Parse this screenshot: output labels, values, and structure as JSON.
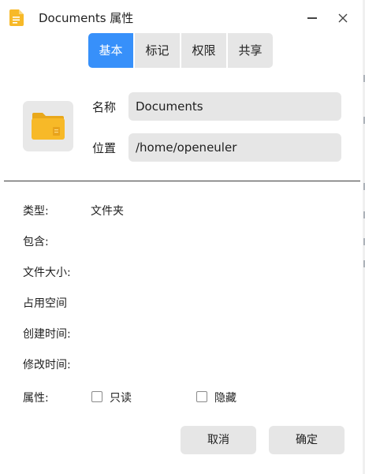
{
  "window": {
    "title": "Documents 属性"
  },
  "tabs": [
    {
      "label": "基本",
      "active": true
    },
    {
      "label": "标记",
      "active": false
    },
    {
      "label": "权限",
      "active": false
    },
    {
      "label": "共享",
      "active": false
    }
  ],
  "basic": {
    "name_label": "名称",
    "name_value": "Documents",
    "location_label": "位置",
    "location_value": "/home/openeuler"
  },
  "info": {
    "type_label": "类型:",
    "type_value": "文件夹",
    "contains_label": "包含:",
    "size_label": "文件大小:",
    "disk_usage_label": "占用空间",
    "created_label": "创建时间:",
    "modified_label": "修改时间:",
    "attributes_label": "属性:"
  },
  "attributes": {
    "readonly_label": "只读",
    "readonly_checked": false,
    "hidden_label": "隐藏",
    "hidden_checked": false
  },
  "buttons": {
    "cancel": "取消",
    "ok": "确定"
  },
  "colors": {
    "accent": "#3790fa",
    "folder": "#f7b928",
    "field_bg": "#e6e6e6"
  }
}
